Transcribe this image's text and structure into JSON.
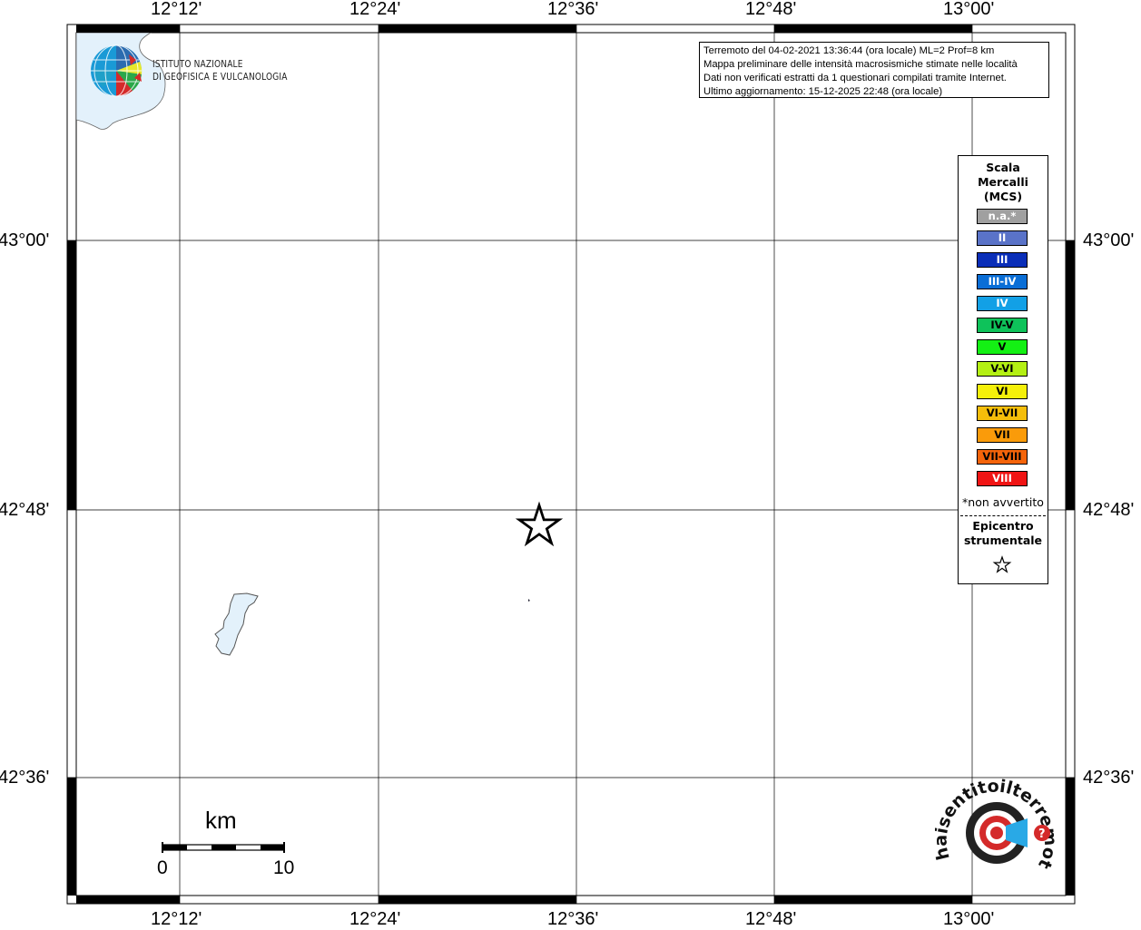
{
  "map": {
    "lon_labels": [
      "12°12'",
      "12°24'",
      "12°36'",
      "12°48'",
      "13°00'"
    ],
    "lat_labels": [
      "43°00'",
      "42°48'",
      "42°36'"
    ]
  },
  "institute": {
    "line1": "ISTITUTO NAZIONALE",
    "line2": "DI GEOFISICA E VULCANOLOGIA"
  },
  "info": {
    "line1": "Terremoto del 04-02-2021 13:36:44 (ora locale) ML=2 Prof=8 km",
    "line2": "Mappa preliminare delle intensità macrosismiche stimate nelle località",
    "line3": "Dati non verificati estratti da 1 questionari compilati tramite Internet.",
    "line4": "Ultimo aggiornamento: 15-12-2025 22:48 (ora locale)"
  },
  "legend": {
    "title1": "Scala",
    "title2": "Mercalli",
    "title3": "(MCS)",
    "scale": [
      {
        "label": "n.a.*",
        "color": "#a0a0a0",
        "text": "#ffffff"
      },
      {
        "label": "II",
        "color": "#5a73c8",
        "text": "#ffffff"
      },
      {
        "label": "III",
        "color": "#0a2eb8",
        "text": "#ffffff"
      },
      {
        "label": "III-IV",
        "color": "#0a6ed6",
        "text": "#ffffff"
      },
      {
        "label": "IV",
        "color": "#12a0e6",
        "text": "#ffffff"
      },
      {
        "label": "IV-V",
        "color": "#0ec25a",
        "text": "#000000"
      },
      {
        "label": "V",
        "color": "#14f014",
        "text": "#000000"
      },
      {
        "label": "V-VI",
        "color": "#b4f014",
        "text": "#000000"
      },
      {
        "label": "VI",
        "color": "#f5f00a",
        "text": "#000000"
      },
      {
        "label": "VI-VII",
        "color": "#f5be0a",
        "text": "#000000"
      },
      {
        "label": "VII",
        "color": "#fa9b0a",
        "text": "#000000"
      },
      {
        "label": "VII-VIII",
        "color": "#f5640a",
        "text": "#000000"
      },
      {
        "label": "VIII",
        "color": "#f01414",
        "text": "#ffffff"
      }
    ],
    "not_felt_note": "*non avvertito",
    "epicenter1": "Epicentro",
    "epicenter2": "strumentale"
  },
  "scalebar": {
    "unit": "km",
    "min": "0",
    "max": "10"
  },
  "badge": {
    "text": "haisentitoilterremoto.it"
  }
}
